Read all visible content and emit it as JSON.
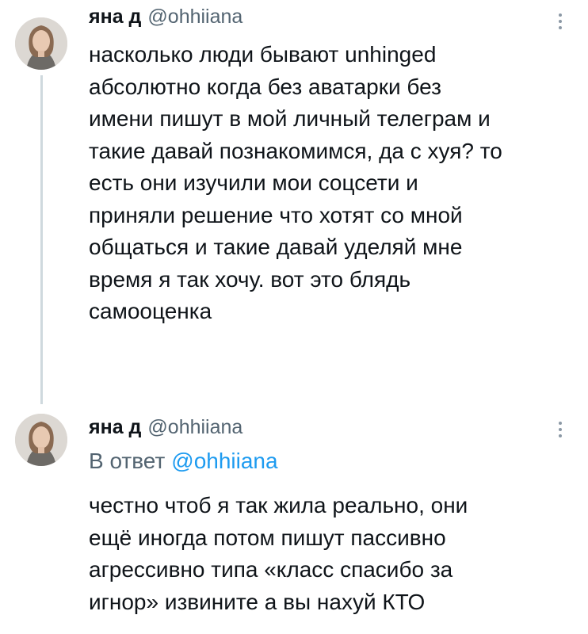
{
  "tweets": [
    {
      "display_name": "яна д",
      "handle": "@ohhiiana",
      "text": "насколько люди бывают unhinged\nабсолютно когда без аватарки без\nимени пишут в мой личный телеграм и\nтакие давай познакомимся, да с хуя? то\nесть они изучили мои соцсети и\nприняли решение что хотят со мной\nобщаться и такие давай уделяй мне\nвремя я так хочу. вот это блядь\nсамооценка"
    },
    {
      "display_name": "яна д",
      "handle": "@ohhiiana",
      "reply_prefix": "В ответ",
      "reply_mention": "@ohhiiana",
      "text": "честно чтоб я так жила реально, они\nещё иногда потом пишут пассивно\nагрессивно типа «класс спасибо за\nигнор» извините а вы нахуй КТО"
    }
  ]
}
